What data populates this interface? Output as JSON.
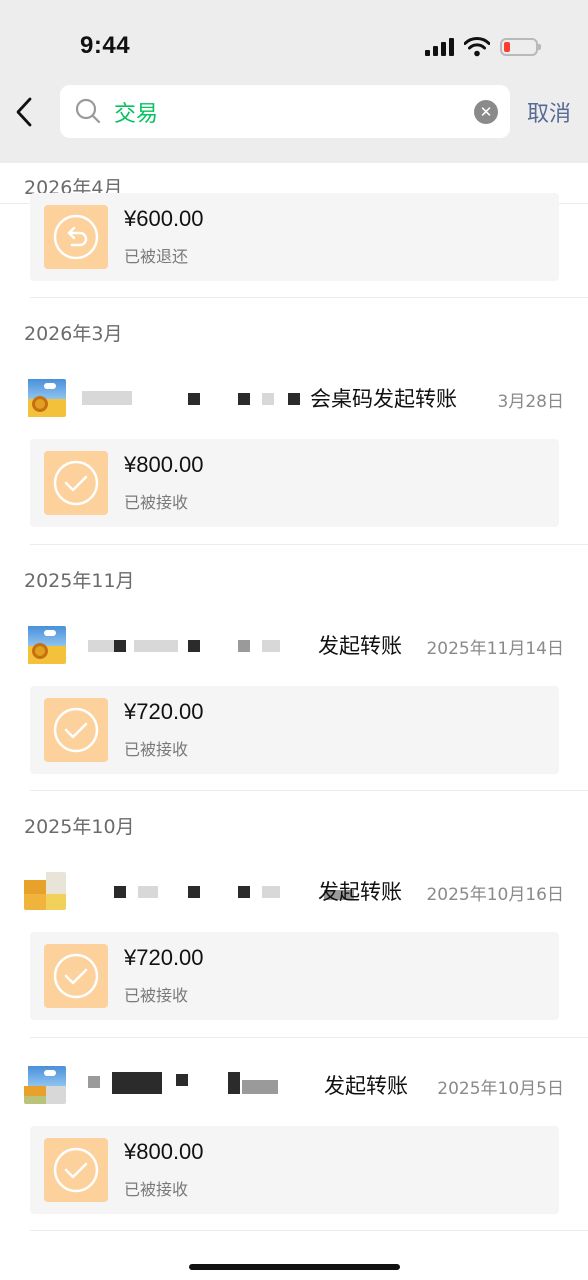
{
  "status_bar": {
    "time": "9:44"
  },
  "search": {
    "query": "交易",
    "cancel_label": "取消"
  },
  "groups": [
    {
      "month": "2026年4月",
      "transactions": [
        {
          "amount": "¥600.00",
          "status": "已被退还",
          "icon": "refund-icon"
        }
      ]
    },
    {
      "month": "2026年3月",
      "transactions": [
        {
          "sender_suffix": "会桌码发起转账",
          "date": "3月28日",
          "amount": "¥800.00",
          "status": "已被接收",
          "icon": "check-icon"
        }
      ]
    },
    {
      "month": "2025年11月",
      "transactions": [
        {
          "sender_suffix": "发起转账",
          "date": "2025年11月14日",
          "amount": "¥720.00",
          "status": "已被接收",
          "icon": "check-icon"
        }
      ]
    },
    {
      "month": "2025年10月",
      "transactions": [
        {
          "sender_suffix": "发起转账",
          "date": "2025年10月16日",
          "amount": "¥720.00",
          "status": "已被接收",
          "icon": "check-icon"
        },
        {
          "sender_suffix": "发起转账",
          "date": "2025年10月5日",
          "amount": "¥800.00",
          "status": "已被接收",
          "icon": "check-icon"
        }
      ]
    }
  ],
  "colors": {
    "accent_green": "#07c160",
    "link_blue": "#576b95",
    "icon_bg": "#fcd19b",
    "card_bg": "#f5f5f5",
    "header_bg": "#ededed"
  }
}
